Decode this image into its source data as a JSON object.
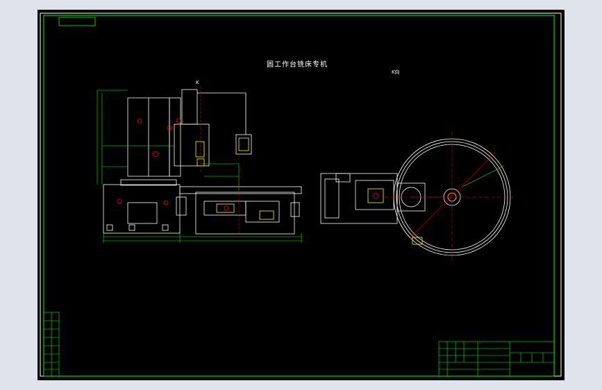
{
  "drawing": {
    "title": "圆工作台铣床专机",
    "view_label": "K向",
    "arrow_label": "K",
    "colors": {
      "background": "#000000",
      "frame": "#00ff00",
      "part": "#ffffff",
      "dimension": "#00ff00",
      "centerline": "#ff0000",
      "highlight": "#ffff00",
      "page": "#dfe3ec"
    }
  }
}
